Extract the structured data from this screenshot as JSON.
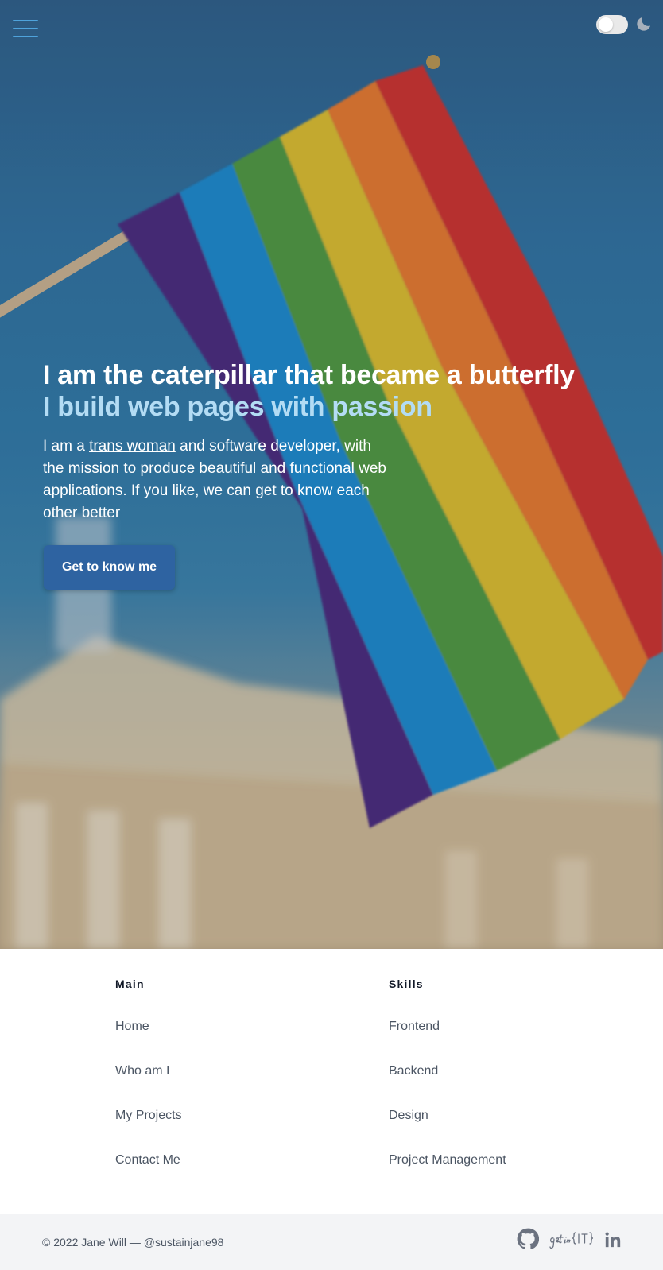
{
  "header": {
    "menu_icon": "hamburger-menu-icon",
    "theme_toggle_state": "off",
    "theme_icon": "moon-icon"
  },
  "hero": {
    "headline": "I am the caterpillar that became a butterfly",
    "subheadline": "I build web pages with passion",
    "intro_before": "I am a ",
    "intro_link": "trans woman",
    "intro_after": " and software developer, with the mission to produce beautiful and functional web applications. If you like, we can get to know each other better",
    "cta_label": "Get to know me"
  },
  "footer_nav": {
    "main": {
      "heading": "Main",
      "items": [
        "Home",
        "Who am I",
        "My Projects",
        "Contact Me"
      ]
    },
    "skills": {
      "heading": "Skills",
      "items": [
        "Frontend",
        "Backend",
        "Design",
        "Project Management"
      ]
    }
  },
  "footer": {
    "copyright": "© 2022 Jane Will — @sustainjane98",
    "social_icons": [
      "github-icon",
      "getinit-logo-icon",
      "linkedin-icon"
    ]
  },
  "colors": {
    "accent_blue": "#2e63a1",
    "subheadline_light_blue": "#b3dcf4",
    "menu_icon_blue": "#4fa3dc"
  }
}
